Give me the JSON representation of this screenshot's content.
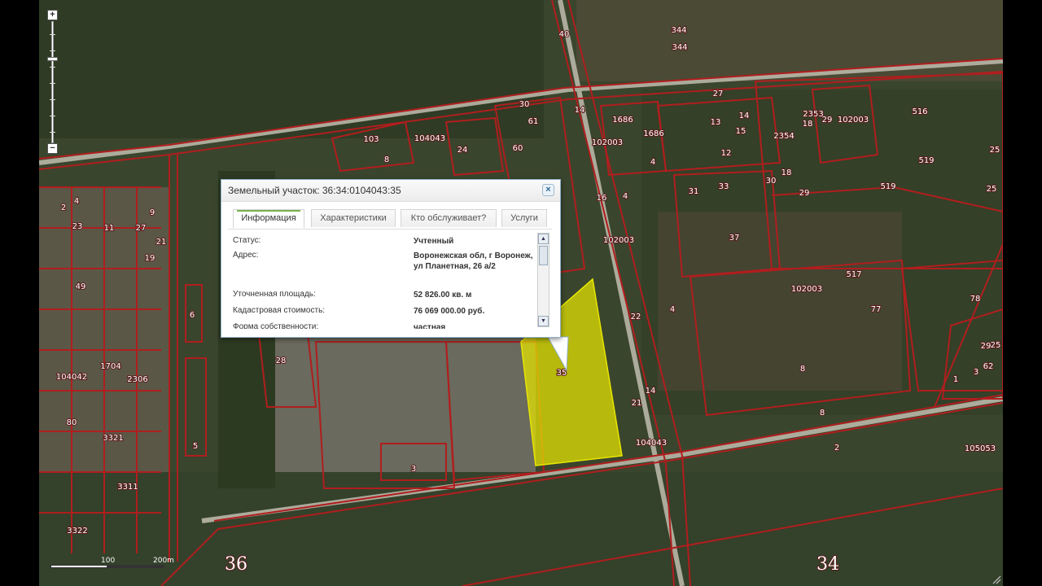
{
  "popup": {
    "title": "Земельный участок: 36:34:0104043:35",
    "close_symbol": "×",
    "tabs": [
      {
        "label": "Информация",
        "active": true
      },
      {
        "label": "Характеристики",
        "active": false
      },
      {
        "label": "Кто обслуживает?",
        "active": false
      },
      {
        "label": "Услуги",
        "active": false
      }
    ],
    "rows": [
      {
        "key": "Статус:",
        "value": "Учтенный"
      },
      {
        "key": "Адрес:",
        "value": "Воронежская обл, г Воронеж, ул Планетная, 26 а/2"
      },
      {
        "key": "Уточненная площадь:",
        "value": "52 826.00 кв. м"
      },
      {
        "key": "Кадастровая стоимость:",
        "value": "76 069 000.00 руб."
      },
      {
        "key": "Форма собственности:",
        "value": "частная"
      }
    ]
  },
  "zoom": {
    "plus": "+",
    "minus": "−",
    "level_fraction": 0.3
  },
  "scale": {
    "label_100": "100",
    "label_200": "200m"
  },
  "selected_parcel": {
    "label": "35",
    "color": "#e8e600"
  },
  "colors": {
    "boundary": "#b01e1e",
    "boundary_light": "#f4d0d0"
  },
  "map_labels": [
    "344",
    "344",
    "40",
    "27",
    "30",
    "103",
    "104043",
    "24",
    "61",
    "60",
    "8",
    "1686",
    "1686",
    "14",
    "13",
    "15",
    "12",
    "2353",
    "18",
    "102003",
    "516",
    "25",
    "519",
    "519",
    "25",
    "29",
    "29",
    "4",
    "33",
    "31",
    "30",
    "18",
    "2354",
    "102003",
    "37",
    "517",
    "102003",
    "4",
    "77",
    "78",
    "8",
    "4",
    "14",
    "16",
    "102003",
    "22",
    "21",
    "104043",
    "14",
    "28",
    "3",
    "2",
    "105053",
    "25",
    "104042",
    "1704",
    "2306",
    "80",
    "3321",
    "3311",
    "3322",
    "49",
    "19",
    "11",
    "23",
    "27",
    "9",
    "6",
    "5",
    "4",
    "2",
    "36",
    "34",
    "33",
    "37",
    "21",
    "29",
    "62",
    "3",
    "1",
    "8"
  ],
  "sheet_labels": [
    "36",
    "34"
  ]
}
